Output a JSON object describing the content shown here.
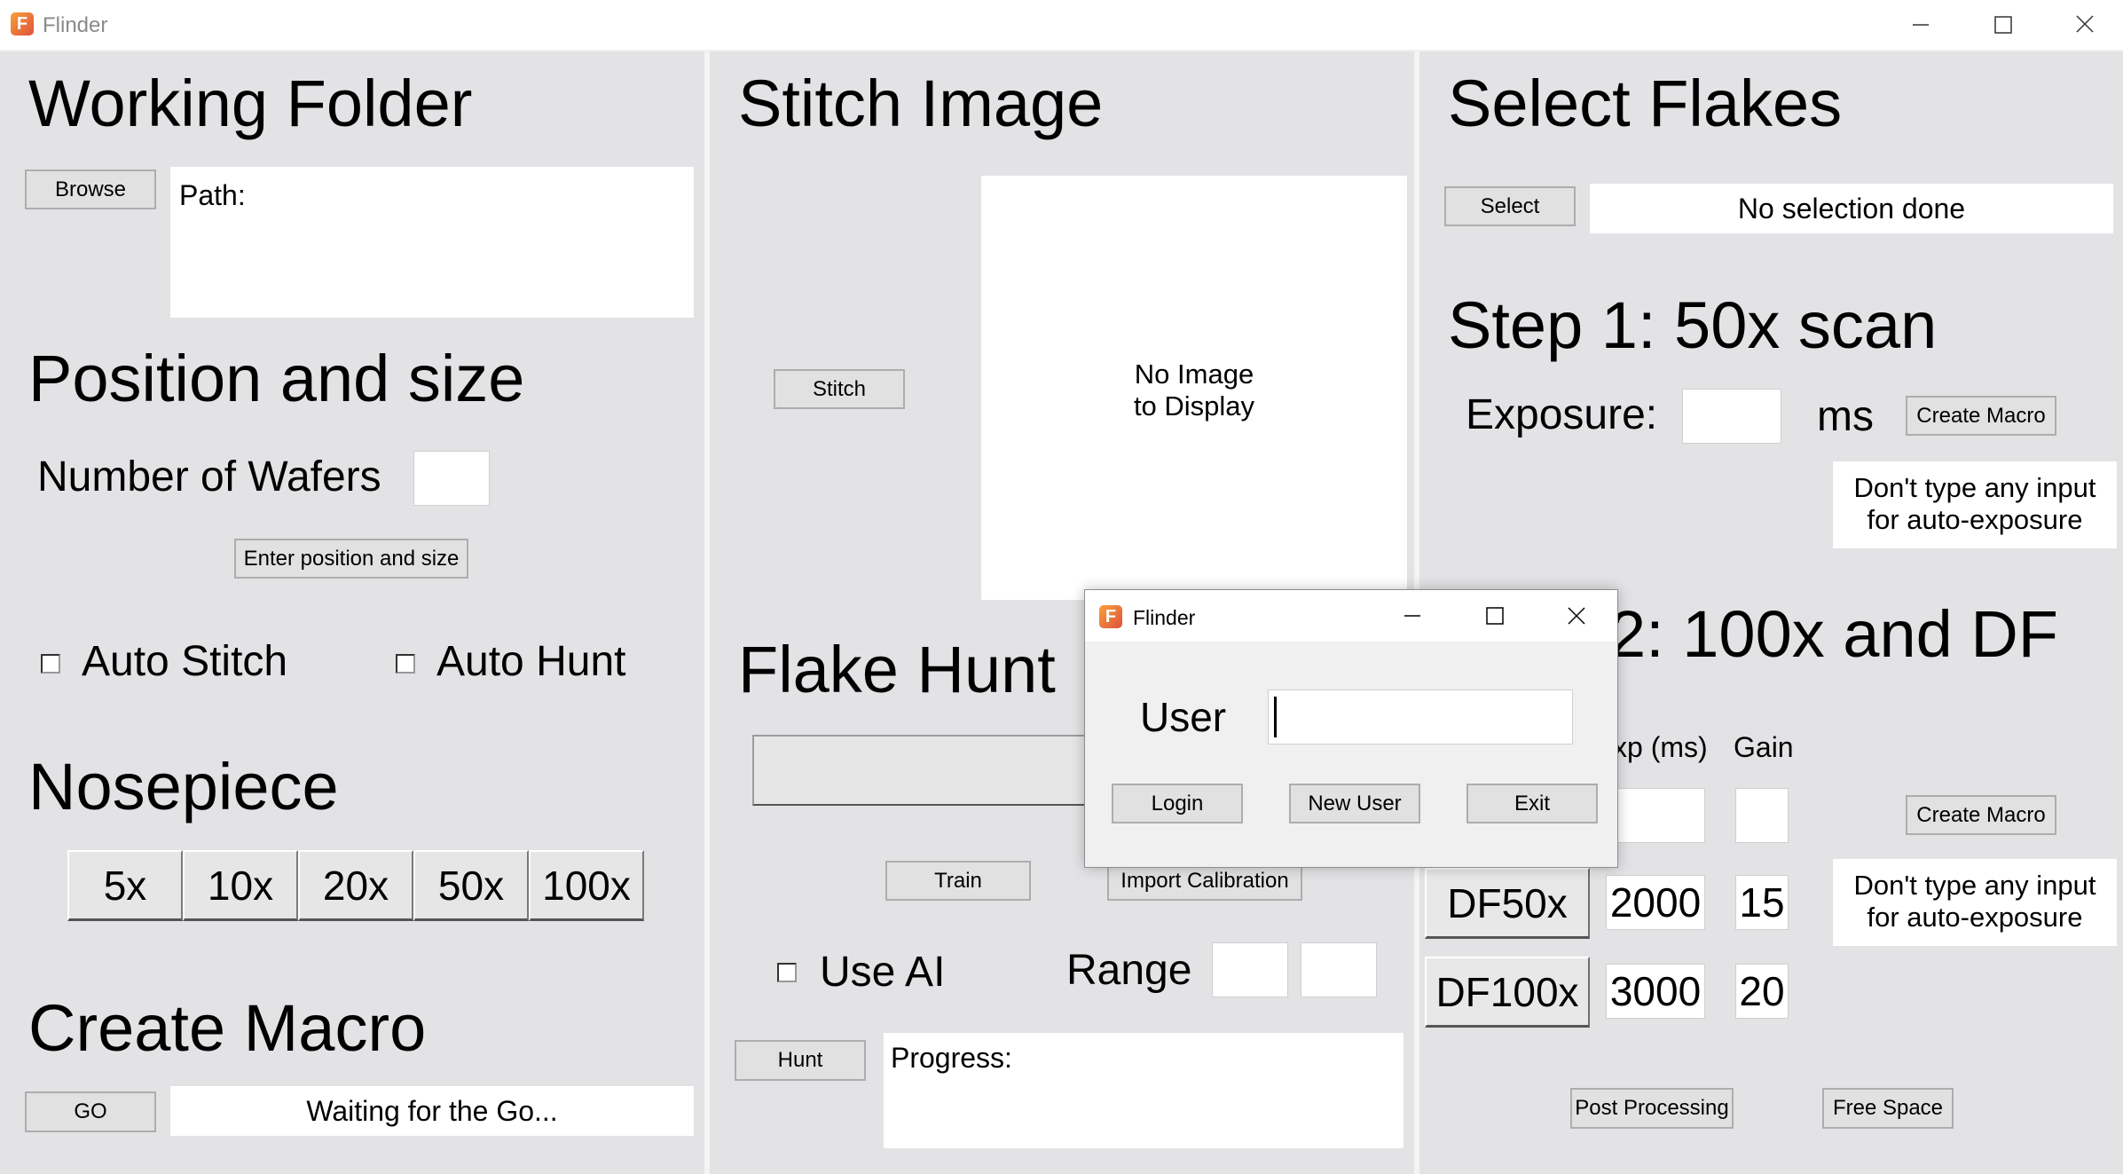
{
  "window": {
    "title": "Flinder",
    "icon_letter": "F"
  },
  "left": {
    "working_folder_heading": "Working Folder",
    "browse_label": "Browse",
    "path_text": "Path:",
    "position_size_heading": "Position and size",
    "num_wafers_label": "Number of Wafers",
    "num_wafers_value": "",
    "enter_position_label": "Enter position and size",
    "auto_stitch_label": "Auto Stitch",
    "auto_hunt_label": "Auto Hunt",
    "nosepiece_heading": "Nosepiece",
    "nosepiece_options": [
      "5x",
      "10x",
      "20x",
      "50x",
      "100x"
    ],
    "create_macro_heading": "Create Macro",
    "go_label": "GO",
    "go_status": "Waiting for the Go..."
  },
  "middle": {
    "stitch_heading": "Stitch Image",
    "stitch_label": "Stitch",
    "no_image_line1": "No Image",
    "no_image_line2": "to Display",
    "flake_hunt_heading": "Flake Hunt",
    "train_label": "Train",
    "import_calibration_label": "Import Calibration",
    "use_ai_label": "Use AI",
    "range_label": "Range",
    "range_min": "",
    "range_max": "",
    "hunt_label": "Hunt",
    "progress_text": "Progress:"
  },
  "right": {
    "select_flakes_heading": "Select Flakes",
    "select_label": "Select",
    "selection_status": "No selection done",
    "step1_heading": "Step 1: 50x scan",
    "exposure_label": "Exposure:",
    "exposure_value": "",
    "ms_label": "ms",
    "create_macro_label": "Create Macro",
    "auto_exposure_hint_line1": "Don't type any input",
    "auto_exposure_hint_line2": "for auto-exposure",
    "step2_heading_visible": "2: 100x and DF",
    "exp_col_label": "xp (ms)",
    "gain_col_label": "Gain",
    "step2_exposure_value": "",
    "step2_gain_value": "",
    "create_macro2_label": "Create Macro",
    "df50_label": "DF50x",
    "df50_exposure": "2000",
    "df50_gain": "15",
    "df100_label": "DF100x",
    "df100_exposure": "3000",
    "df100_gain": "20",
    "auto_exposure_hint2_line1": "Don't type any input",
    "auto_exposure_hint2_line2": "for auto-exposure",
    "post_processing_label": "Post Processing",
    "free_space_label": "Free Space"
  },
  "dialog": {
    "title": "Flinder",
    "user_label": "User",
    "user_value": "",
    "login_label": "Login",
    "new_user_label": "New User",
    "exit_label": "Exit"
  }
}
